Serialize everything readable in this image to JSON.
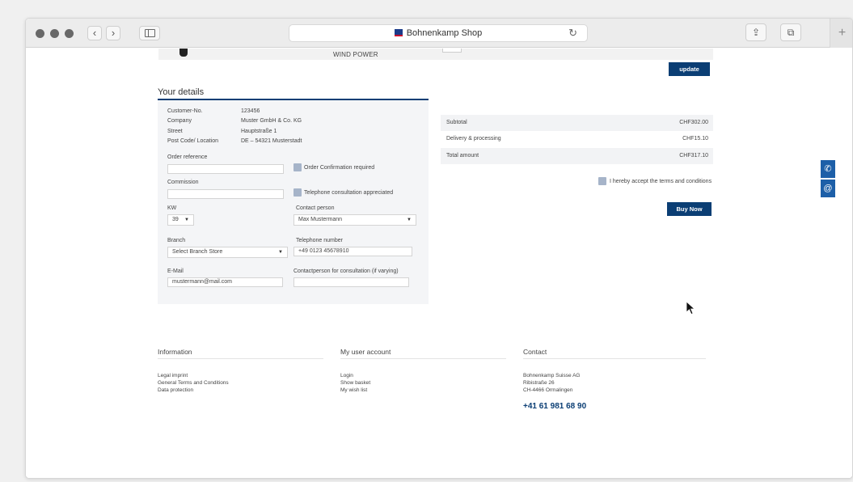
{
  "browser": {
    "title": "Bohnenkamp Shop",
    "back_icon": "‹",
    "forward_icon": "›",
    "reload_icon": "↻",
    "share_icon": "⇪",
    "tabs_icon": "⧉",
    "newtab_icon": "+"
  },
  "cart_strip": {
    "product_name": "WIND POWER",
    "update_label": "update"
  },
  "details": {
    "heading": "Your details",
    "customer_no_label": "Customer-No.",
    "customer_no": "123456",
    "company_label": "Company",
    "company": "Muster GmbH & Co. KG",
    "street_label": "Street",
    "street": "Hauptstraße 1",
    "postcode_label": "Post Code/ Location",
    "postcode": "DE – 54321 Musterstadt",
    "order_ref_label": "Order reference",
    "order_ref_value": "",
    "order_confirm_label": "Order Confirmation required",
    "commission_label": "Commission",
    "commission_value": "",
    "telephone_consult_label": "Telephone consultation appreciated",
    "kw_label": "KW",
    "kw_value": "39",
    "contact_person_label": "Contact person",
    "contact_person_value": "Max Mustermann",
    "branch_label": "Branch",
    "branch_value": "Select Branch Store",
    "telephone_label": "Telephone number",
    "telephone_value": "+49 0123 45678910",
    "email_label": "E-Mail",
    "email_value": "mustermann@mail.com",
    "contact_varying_label": "Contactperson for consultation (if varying)",
    "contact_varying_value": ""
  },
  "summary": {
    "subtotal_label": "Subtotal",
    "subtotal_value": "CHF302.00",
    "delivery_label": "Delivery & processing",
    "delivery_value": "CHF15.10",
    "total_label": "Total amount",
    "total_value": "CHF317.10",
    "terms_label": "I hereby accept the terms and conditions",
    "buy_label": "Buy Now"
  },
  "footer": {
    "information": {
      "title": "Information",
      "links": [
        "Legal imprint",
        "General Terms and Conditions",
        "Data protection"
      ]
    },
    "account": {
      "title": "My user account",
      "links": [
        "Login",
        "Show basket",
        "My wish list"
      ]
    },
    "contact": {
      "title": "Contact",
      "lines": [
        "Bohnenkamp Suisse AG",
        "Ribistraße 26",
        "CH-4466 Ormalingen"
      ],
      "phone": "+41 61 981 68 90"
    }
  },
  "side": {
    "phone_icon": "✆",
    "mail_icon": "@"
  },
  "colors": {
    "brand_blue": "#0b3e74",
    "side_blue": "#1d5fa8",
    "checkbox": "#a6b4c9"
  }
}
